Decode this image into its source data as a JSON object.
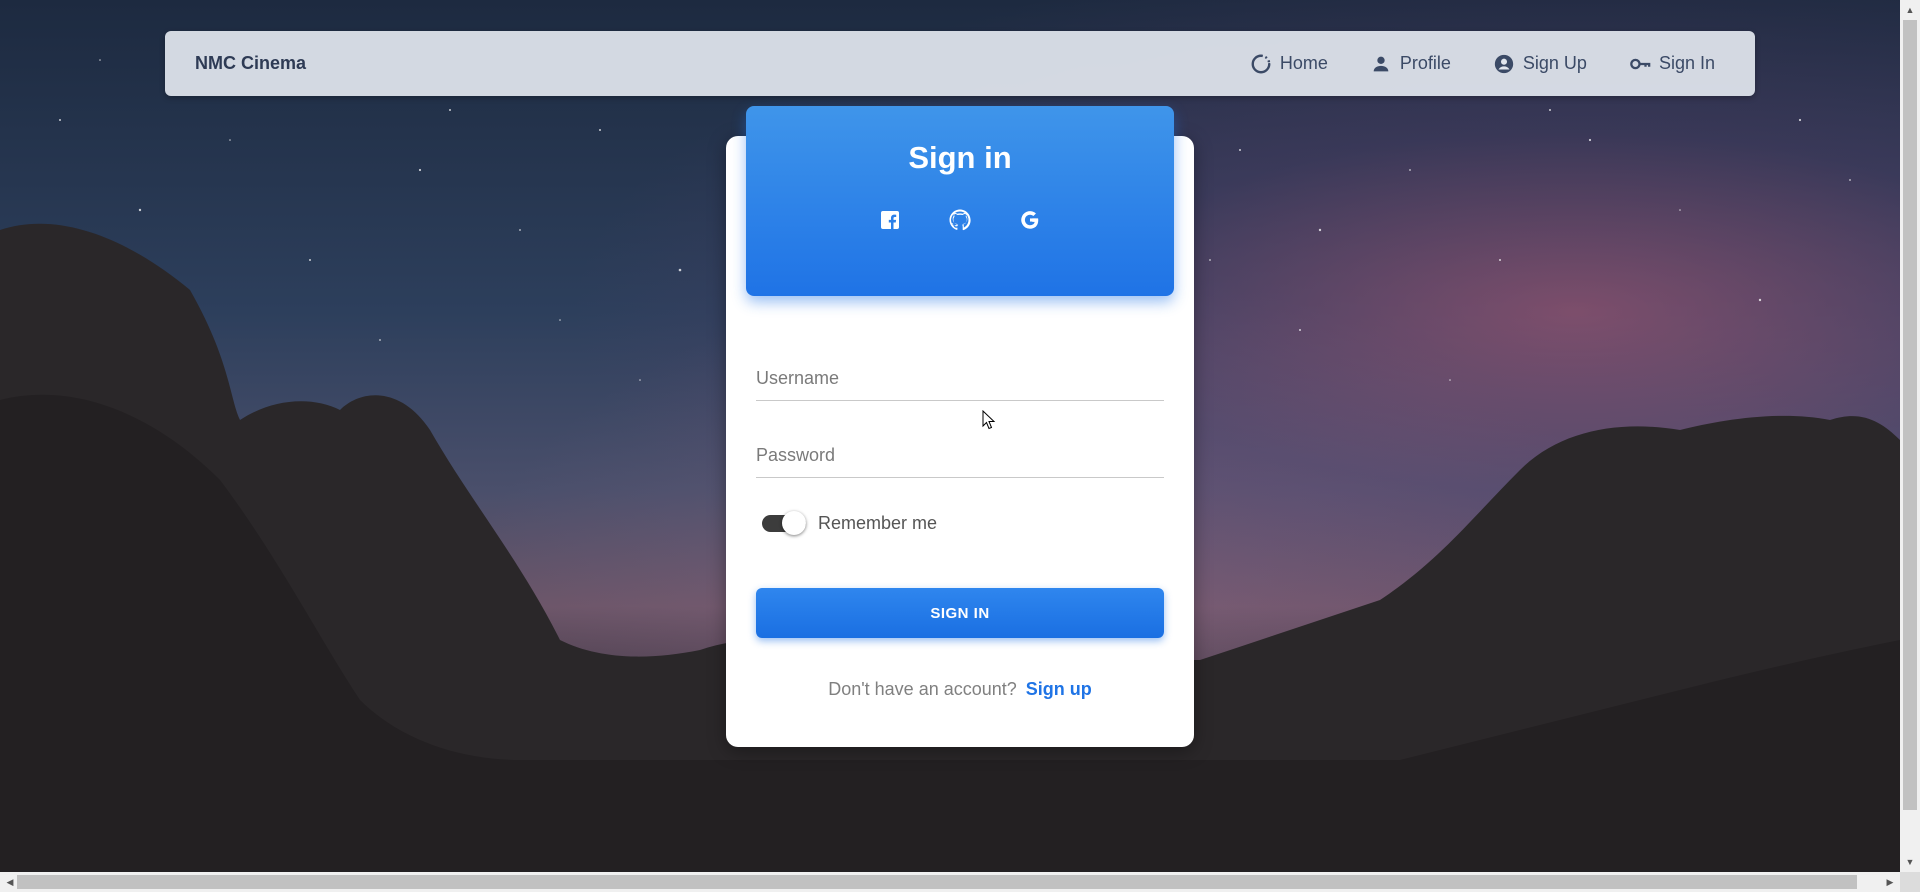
{
  "navbar": {
    "brand": "NMC Cinema",
    "links": [
      {
        "label": "Home",
        "icon": "loading-circle-icon"
      },
      {
        "label": "Profile",
        "icon": "user-icon"
      },
      {
        "label": "Sign Up",
        "icon": "account-circle-icon"
      },
      {
        "label": "Sign In",
        "icon": "key-icon"
      }
    ]
  },
  "card": {
    "title": "Sign in",
    "social": [
      "facebook-icon",
      "github-icon",
      "google-icon"
    ],
    "username_placeholder": "Username",
    "password_placeholder": "Password",
    "remember_label": "Remember me",
    "remember_checked": true,
    "submit_label": "SIGN IN",
    "signup_question": "Don't have an account?",
    "signup_link": "Sign up"
  },
  "colors": {
    "primary": "#1f73e6",
    "navbar_bg": "#e1e6ee",
    "brand_text": "#2e3b55"
  }
}
